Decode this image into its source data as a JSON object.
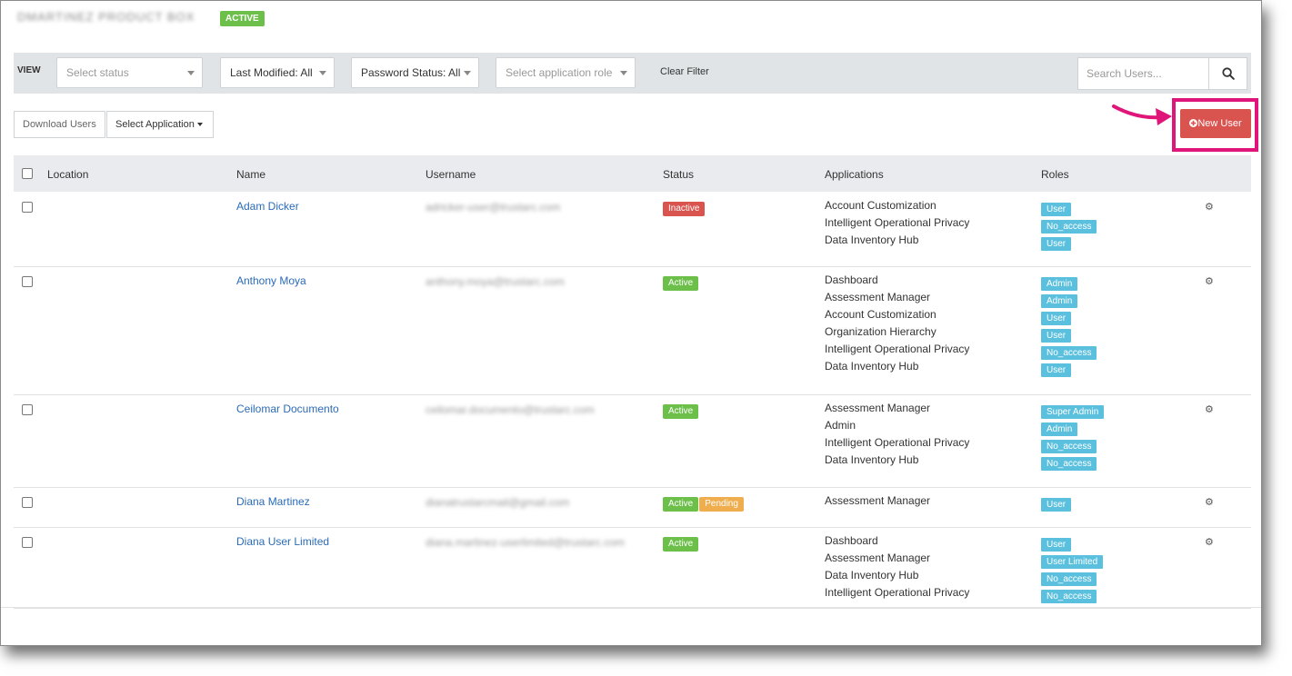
{
  "header": {
    "title": "DMARTINEZ PRODUCT BOX",
    "badge": "ACTIVE"
  },
  "filters": {
    "view_label": "VIEW",
    "status_placeholder": "Select status",
    "last_modified": "Last Modified: All",
    "password_status": "Password Status: All",
    "role_placeholder": "Select application role",
    "clear_filter": "Clear Filter",
    "search_placeholder": "Search Users..."
  },
  "toolbar": {
    "download_label": "Download Users",
    "select_application_label": "Select Application",
    "new_user_label": "New User"
  },
  "table": {
    "headers": {
      "location": "Location",
      "name": "Name",
      "username": "Username",
      "status": "Status",
      "applications": "Applications",
      "roles": "Roles"
    },
    "rows": [
      {
        "name": "Adam Dicker",
        "username": "adricker-user@trustarc.com",
        "statuses": [
          {
            "label": "Inactive",
            "color": "#d9534f"
          }
        ],
        "apps": [
          "Account Customization",
          "Intelligent Operational Privacy",
          "Data Inventory Hub"
        ],
        "roles": [
          "User",
          "No_access",
          "User"
        ]
      },
      {
        "name": "Anthony Moya",
        "username": "anthony.moya@trustarc.com",
        "statuses": [
          {
            "label": "Active",
            "color": "#6cc04a"
          }
        ],
        "apps": [
          "Dashboard",
          "Assessment Manager",
          "Account Customization",
          "Organization Hierarchy",
          "Intelligent Operational Privacy",
          "Data Inventory Hub"
        ],
        "roles": [
          "Admin",
          "Admin",
          "User",
          "User",
          "No_access",
          "User"
        ]
      },
      {
        "name": "Ceilomar Documento",
        "username": "ceilomar.documento@trustarc.com",
        "statuses": [
          {
            "label": "Active",
            "color": "#6cc04a"
          }
        ],
        "apps": [
          "Assessment Manager",
          "Admin",
          "Intelligent Operational Privacy",
          "Data Inventory Hub"
        ],
        "roles": [
          "Super Admin",
          "Admin",
          "No_access",
          "No_access"
        ]
      },
      {
        "name": "Diana Martinez",
        "username": "dianatrustarcmail@gmail.com",
        "statuses": [
          {
            "label": "Active",
            "color": "#6cc04a"
          },
          {
            "label": "Pending",
            "color": "#f0ad4e"
          }
        ],
        "apps": [
          "Assessment Manager"
        ],
        "roles": [
          "User"
        ]
      },
      {
        "name": "Diana User Limited",
        "username": "diana.martinez-userlimited@trustarc.com",
        "statuses": [
          {
            "label": "Active",
            "color": "#6cc04a"
          }
        ],
        "apps": [
          "Dashboard",
          "Assessment Manager",
          "Data Inventory Hub",
          "Intelligent Operational Privacy"
        ],
        "roles": [
          "User",
          "User Limited",
          "No_access",
          "No_access"
        ]
      }
    ]
  },
  "icons": {
    "search": "search-icon",
    "gear": "gear-icon",
    "plus": "plus-circle-icon"
  },
  "colors": {
    "accent_blue": "#2a6bb8",
    "danger": "#d9534f",
    "success": "#6cc04a",
    "warning": "#f0ad4e",
    "info": "#5bc0de",
    "highlight": "#e0157a"
  }
}
